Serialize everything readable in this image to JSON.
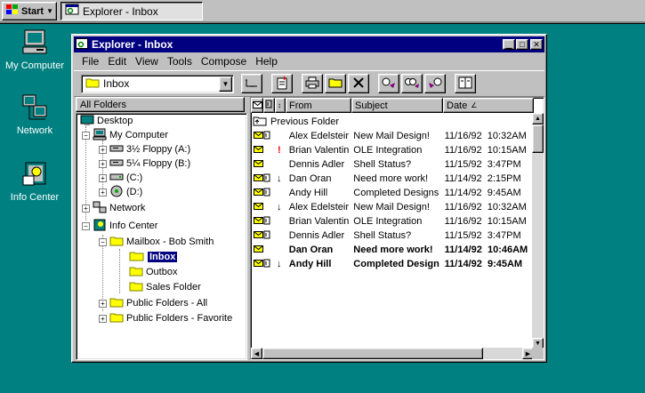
{
  "taskbar": {
    "start_label": "Start",
    "task_label": "Explorer - Inbox"
  },
  "desktop": {
    "icons": [
      {
        "label": "My Computer"
      },
      {
        "label": "Network"
      },
      {
        "label": "Info Center"
      }
    ]
  },
  "window": {
    "title": "Explorer - Inbox",
    "menu": [
      "File",
      "Edit",
      "View",
      "Tools",
      "Compose",
      "Help"
    ],
    "folder_combo_value": "Inbox"
  },
  "tree": {
    "header": "All Folders",
    "items": [
      {
        "label": "Desktop"
      },
      {
        "label": "My Computer"
      },
      {
        "label": "3½ Floppy (A:)"
      },
      {
        "label": "5¼ Floppy (B:)"
      },
      {
        "label": "(C:)"
      },
      {
        "label": "(D:)"
      },
      {
        "label": "Network"
      },
      {
        "label": "Info Center"
      },
      {
        "label": "Mailbox - Bob Smith"
      },
      {
        "label": "Inbox"
      },
      {
        "label": "Outbox"
      },
      {
        "label": "Sales Folder"
      },
      {
        "label": "Public Folders - All"
      },
      {
        "label": "Public Folders - Favorite"
      }
    ]
  },
  "list": {
    "columns": {
      "from": "From",
      "subject": "Subject",
      "date": "Date"
    },
    "previous_folder": "Previous Folder",
    "rows": [
      {
        "from": "Alex Edelsteir",
        "subject": "New Mail Design!",
        "date": "11/16/92  10:32AM",
        "attach": true,
        "importance": ""
      },
      {
        "from": "Brian Valentin",
        "subject": "OLE Integration",
        "date": "11/16/92  10:15AM",
        "attach": false,
        "importance": "!"
      },
      {
        "from": "Dennis Adler",
        "subject": "Shell Status?",
        "date": "11/15/92  3:47PM",
        "attach": false,
        "importance": ""
      },
      {
        "from": "Dan Oran",
        "subject": "Need more work!",
        "date": "11/14/92  2:15PM",
        "attach": true,
        "importance": "↓"
      },
      {
        "from": "Andy Hill",
        "subject": "Completed Designs",
        "date": "11/14/92  9:45AM",
        "attach": true,
        "importance": ""
      },
      {
        "from": "Alex Edelsteir",
        "subject": "New Mail Design!",
        "date": "11/16/92  10:32AM",
        "attach": false,
        "importance": "↓"
      },
      {
        "from": "Brian Valentin",
        "subject": "OLE Integration",
        "date": "11/16/92  10:15AM",
        "attach": true,
        "importance": ""
      },
      {
        "from": "Dennis Adler",
        "subject": "Shell Status?",
        "date": "11/15/92  3:47PM",
        "attach": true,
        "importance": ""
      },
      {
        "from": "Dan Oran",
        "subject": "Need more work!",
        "date": "11/14/92  10:46AM",
        "attach": false,
        "importance": "",
        "unread": true
      },
      {
        "from": "Andy Hill",
        "subject": "Completed Design",
        "date": "11/14/92  9:45AM",
        "attach": true,
        "importance": "↓",
        "unread": true
      }
    ]
  }
}
